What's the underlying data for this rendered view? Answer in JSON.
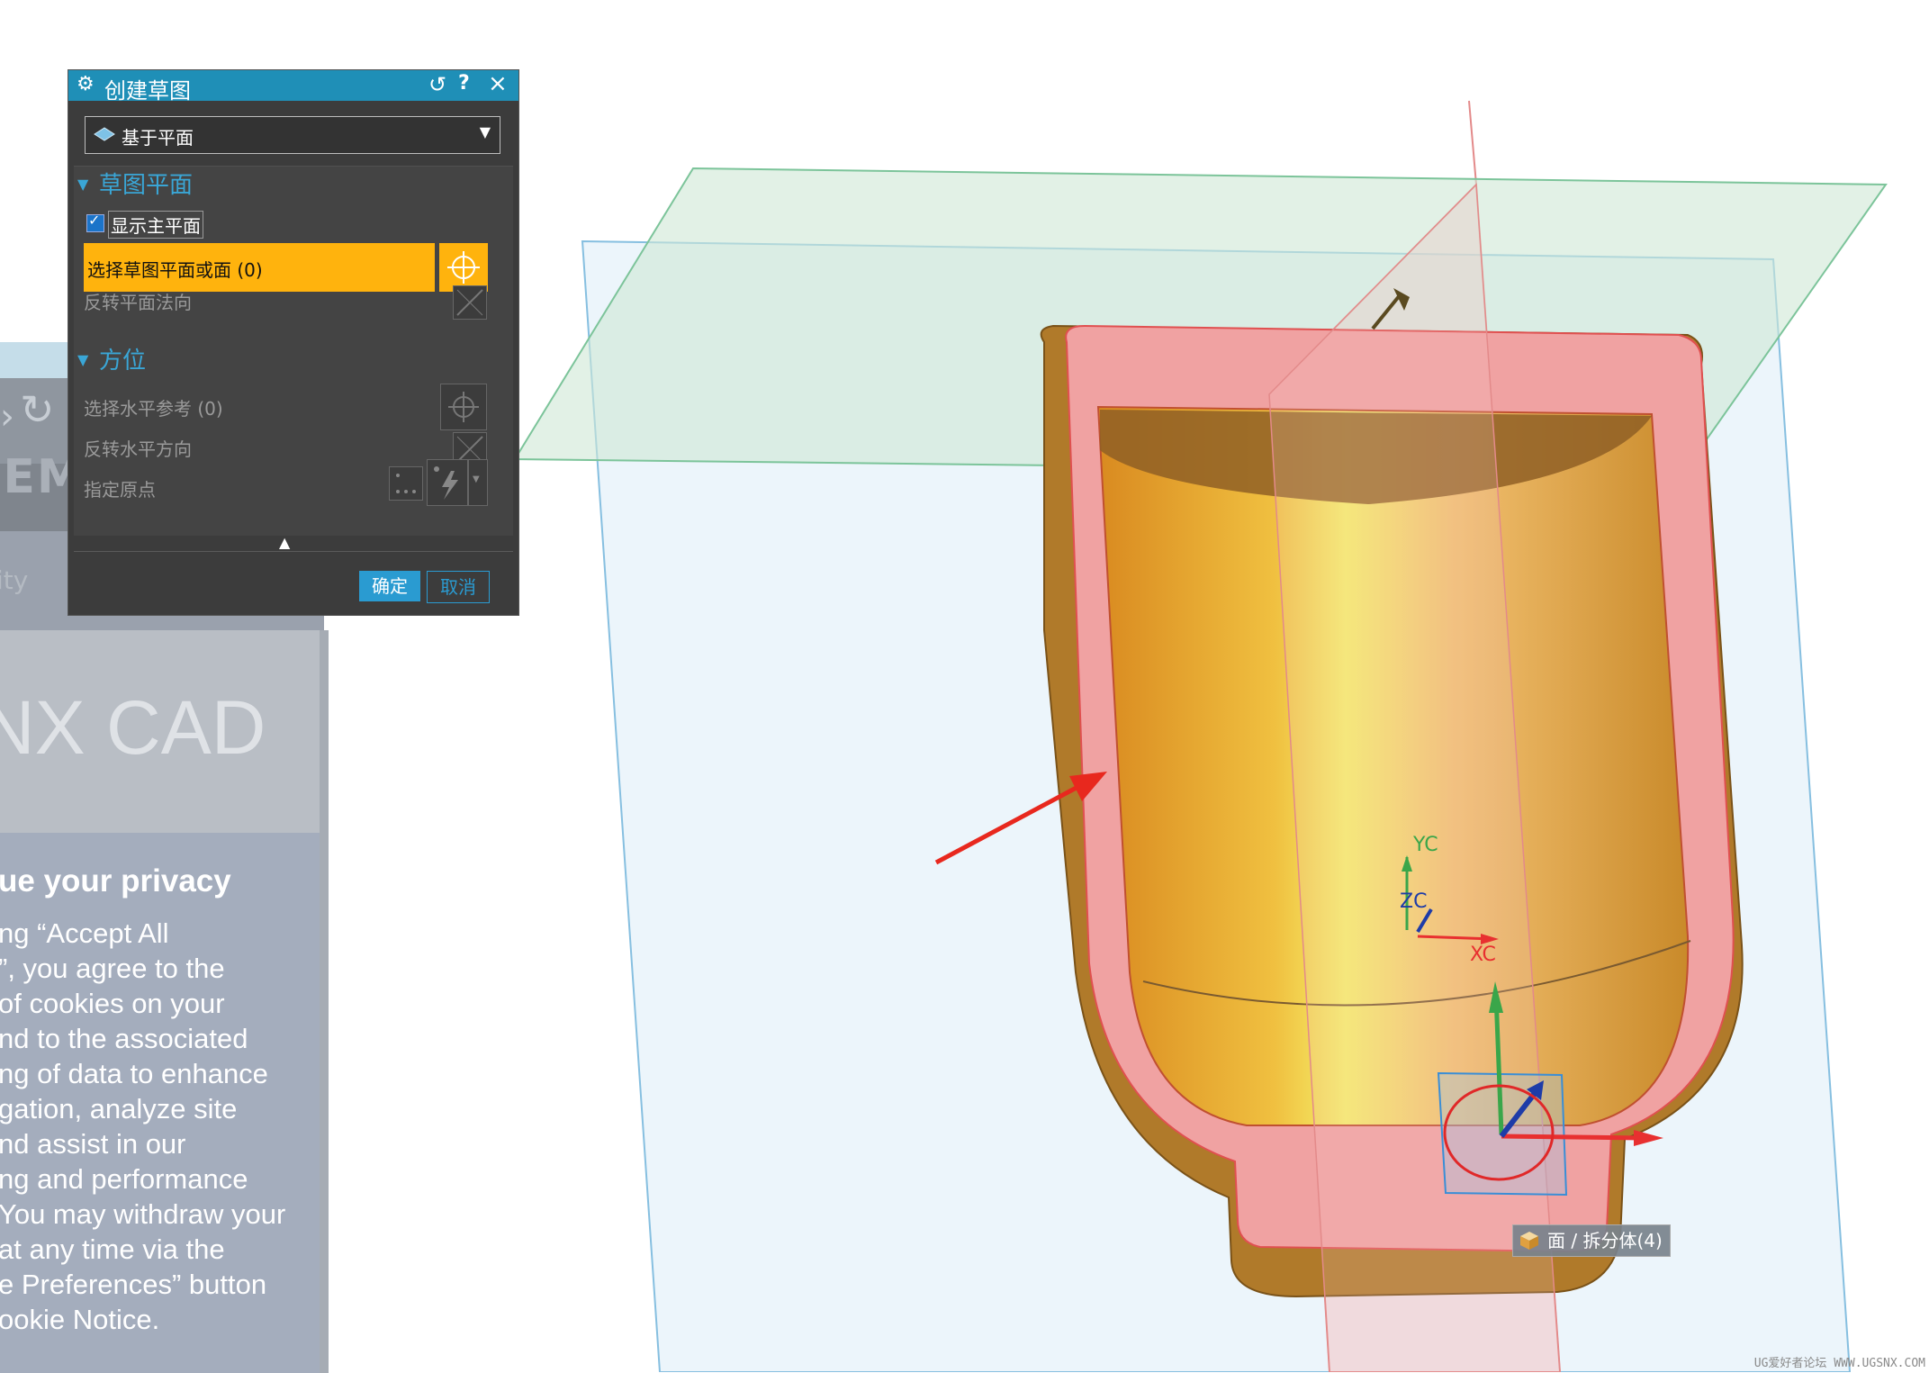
{
  "background_page": {
    "brand_fragment": "IEM",
    "link_fragment": "ity",
    "product_title": "NX CAD",
    "cookie": {
      "title": "ue your privacy",
      "lines": [
        "ng “Accept All",
        "”, you agree to the",
        "of cookies on your",
        "nd to the associated",
        "ng of data to enhance",
        "gation, analyze site",
        "nd assist in our",
        "ng and performance",
        "You may withdraw your",
        "at any time via the",
        "e Preferences” button",
        "ookie Notice."
      ]
    }
  },
  "dialog": {
    "title": "创建草图",
    "type_dropdown": {
      "value": "基于平面",
      "icon": "plane-icon"
    },
    "section_sketch_plane": {
      "title": "草图平面",
      "show_principal_plane_label": "显示主平面",
      "show_principal_plane_checked": true,
      "select_plane_label": "选择草图平面或面 (0)",
      "reverse_normal_label": "反转平面法向"
    },
    "section_orientation": {
      "title": "方位",
      "select_horizontal_ref_label": "选择水平参考 (0)",
      "reverse_horizontal_label": "反转水平方向",
      "specify_origin_label": "指定原点"
    },
    "ok_label": "确定",
    "cancel_label": "取消"
  },
  "viewport": {
    "axes": {
      "x": "XC",
      "y": "YC",
      "z": "ZC"
    },
    "tooltip": "面 / 拆分体(4)"
  },
  "watermark": "UG爱好者论坛 WWW.UGSNX.COM",
  "colors": {
    "dialog_accent": "#1f8fb7",
    "selection_highlight": "#ffb30d",
    "part_body": "#e9a23a",
    "selected_face": "#f0a0a0"
  }
}
